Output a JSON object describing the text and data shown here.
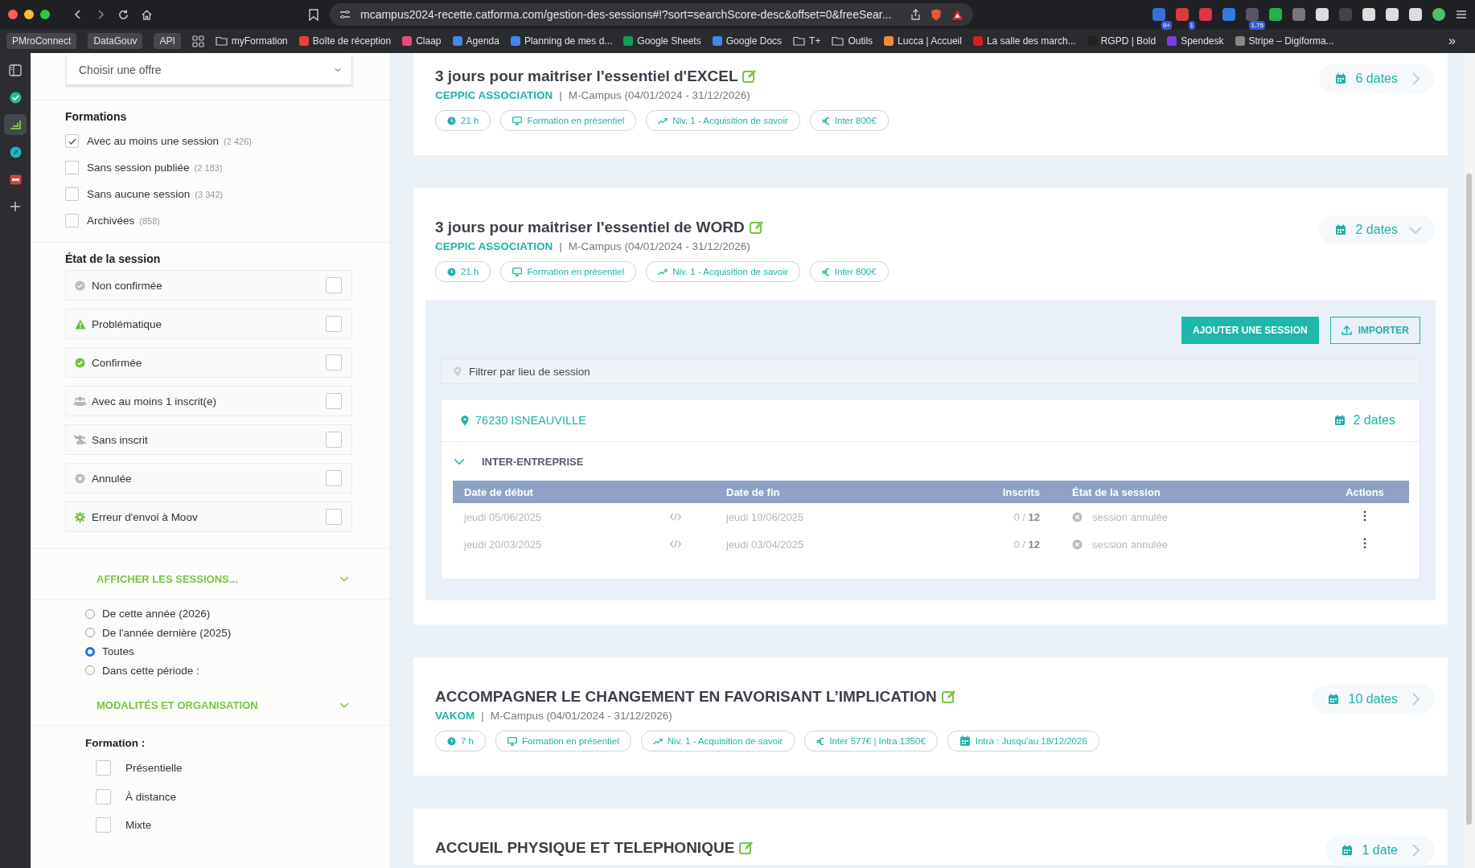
{
  "browser": {
    "url": "mcampus2024-recette.catforma.com/gestion-des-sessions#!?sort=searchScore-desc&offset=0&freeSear...",
    "extensions": [
      {
        "color": "#3b6fd8",
        "badge": "9+"
      },
      {
        "color": "#d83b3b",
        "badge": "1"
      },
      {
        "color": "#e0344a"
      },
      {
        "color": "#2f7de1"
      },
      {
        "color": "#556",
        "badge": "1.75"
      },
      {
        "color": "#22b14c"
      },
      {
        "color": "#777777"
      },
      {
        "color": "#dddddd"
      },
      {
        "color": "#444444"
      },
      {
        "color": "#dddddd"
      },
      {
        "color": "#dddddd"
      },
      {
        "color": "#dddddd"
      }
    ],
    "bookmarks": [
      {
        "label": "PMroConnect",
        "kind": "button"
      },
      {
        "label": "DataGouv",
        "kind": "button"
      },
      {
        "label": "API",
        "kind": "button"
      },
      {
        "kind": "apps"
      },
      {
        "label": "myFormation",
        "kind": "folder"
      },
      {
        "label": "Boîte de réception",
        "kind": "site",
        "color": "#ea4335"
      },
      {
        "label": "Claap",
        "kind": "site",
        "color": "#e84a7f"
      },
      {
        "label": "Agenda",
        "kind": "site",
        "color": "#4285f4"
      },
      {
        "label": "Planning de mes d...",
        "kind": "site",
        "color": "#4285f4"
      },
      {
        "label": "Google Sheets",
        "kind": "site",
        "color": "#0f9d58"
      },
      {
        "label": "Google Docs",
        "kind": "site",
        "color": "#4285f4"
      },
      {
        "label": "T+",
        "kind": "folder"
      },
      {
        "label": "Outils",
        "kind": "folder"
      },
      {
        "label": "Lucca | Accueil",
        "kind": "site",
        "color": "#f08a3c"
      },
      {
        "label": "La salle des march...",
        "kind": "site",
        "color": "#d81e1e"
      },
      {
        "label": "RGPD | Bold",
        "kind": "site",
        "color": "#222222"
      },
      {
        "label": "Spendesk",
        "kind": "site",
        "color": "#7b3fe4"
      },
      {
        "label": "Stripe – Digiforma...",
        "kind": "site",
        "color": "#888888"
      }
    ],
    "more": "»"
  },
  "rail": [
    {
      "selected": false
    },
    {
      "selected": false
    },
    {
      "selected": true
    },
    {
      "selected": false
    },
    {
      "selected": false
    },
    {
      "selected": false
    }
  ],
  "filters": {
    "offer_select": {
      "placeholder": "Choisir une offre"
    },
    "formations": {
      "title": "Formations",
      "options": [
        {
          "label": "Avec au moins une session",
          "count": "(2 426)",
          "checked": true
        },
        {
          "label": "Sans session publiée",
          "count": "(2 183)",
          "checked": false
        },
        {
          "label": "Sans aucune session",
          "count": "(3 342)",
          "checked": false
        },
        {
          "label": "Archivées",
          "count": "(858)",
          "checked": false
        }
      ]
    },
    "session_state": {
      "title": "État de la session",
      "options": [
        {
          "label": "Non confirmée",
          "kind": "unconfirmed",
          "checked": false
        },
        {
          "label": "Problématique",
          "kind": "warning",
          "checked": false
        },
        {
          "label": "Confirmée",
          "kind": "confirmed",
          "checked": false
        },
        {
          "label": "Avec au moins 1 inscrit(e)",
          "kind": "people",
          "checked": false
        },
        {
          "label": "Sans inscrit",
          "kind": "no-people",
          "checked": false
        },
        {
          "label": "Annulée",
          "kind": "cancelled",
          "checked": false
        },
        {
          "label": "Erreur d'envoi à Moov",
          "kind": "error",
          "checked": false
        }
      ]
    },
    "show_sessions": {
      "title": "AFFICHER LES SESSIONS...",
      "expanded": true,
      "options": [
        {
          "label": "De cette année (2026)",
          "selected": false
        },
        {
          "label": "De l'année dernière (2025)",
          "selected": false
        },
        {
          "label": "Toutes",
          "selected": true
        },
        {
          "label": "Dans cette période :",
          "selected": false
        }
      ]
    },
    "modalities": {
      "title": "MODALITÉS ET ORGANISATION",
      "expanded": true,
      "label": "Formation :",
      "options": [
        {
          "label": "Présentielle",
          "checked": false
        },
        {
          "label": "À distance",
          "checked": false
        },
        {
          "label": "Mixte",
          "checked": false
        }
      ]
    }
  },
  "courses": [
    {
      "title": "3 jours pour maitriser l'essentiel d'EXCEL",
      "org": "CEPPIC ASSOCIATION",
      "separator": "|",
      "campus": "M-Campus (04/01/2024 - 31/12/2026)",
      "dates": "6 dates",
      "expanded": false,
      "tags": [
        {
          "kind": "duration",
          "label": "21 h"
        },
        {
          "kind": "mode",
          "label": "Formation en présentiel"
        },
        {
          "kind": "level",
          "label": "Niv. 1 - Acquisition de savoir"
        },
        {
          "kind": "price",
          "label": "Inter 800€"
        }
      ]
    },
    {
      "title": "3 jours pour maitriser l'essentiel de WORD",
      "org": "CEPPIC ASSOCIATION",
      "separator": "|",
      "campus": "M-Campus (04/01/2024 - 31/12/2026)",
      "dates": "2 dates",
      "expanded": true,
      "tags": [
        {
          "kind": "duration",
          "label": "21 h"
        },
        {
          "kind": "mode",
          "label": "Formation en présentiel"
        },
        {
          "kind": "level",
          "label": "Niv. 1 - Acquisition de savoir"
        },
        {
          "kind": "price",
          "label": "Inter 800€"
        }
      ],
      "detail": {
        "add_button": "AJOUTER UNE SESSION",
        "import_button": "IMPORTER",
        "filter": {
          "placeholder": "Filtrer par lieu de session"
        },
        "locations": [
          {
            "place": "76230 ISNEAUVILLE",
            "dates": "2 dates",
            "groups": [
              {
                "name": "INTER-ENTREPRISE",
                "expanded": true,
                "columns": [
                  "Date de début",
                  "Date de fin",
                  "Inscrits",
                  "État de la session",
                  "Actions"
                ],
                "rows": [
                  {
                    "start": "jeudi 05/06/2025",
                    "end": "jeudi 19/06/2025",
                    "enrolled": "0 / **12**",
                    "state": "session annulée",
                    "kind": "cancelled"
                  },
                  {
                    "start": "jeudi 20/03/2025",
                    "end": "jeudi 03/04/2025",
                    "enrolled": "0 / **12**",
                    "state": "session annulée",
                    "kind": "cancelled"
                  }
                ]
              }
            ]
          }
        ]
      }
    },
    {
      "title": "ACCOMPAGNER LE CHANGEMENT EN FAVORISANT L’IMPLICATION",
      "org": "VAKOM",
      "separator": "|",
      "campus": "M-Campus (04/01/2024 - 31/12/2026)",
      "dates": "10 dates",
      "expanded": false,
      "tags": [
        {
          "kind": "duration",
          "label": "7 h"
        },
        {
          "kind": "mode",
          "label": "Formation en présentiel"
        },
        {
          "kind": "level",
          "label": "Niv. 1 - Acquisition de savoir"
        },
        {
          "kind": "price",
          "label": "Inter 577€ | Intra 1350€"
        },
        {
          "kind": "calendar",
          "label": "Intra : Jusqu'au 18/12/2026"
        }
      ]
    },
    {
      "title": "ACCUEIL PHYSIQUE ET TELEPHONIQUE",
      "dates": "1 date",
      "expanded": false
    }
  ]
}
